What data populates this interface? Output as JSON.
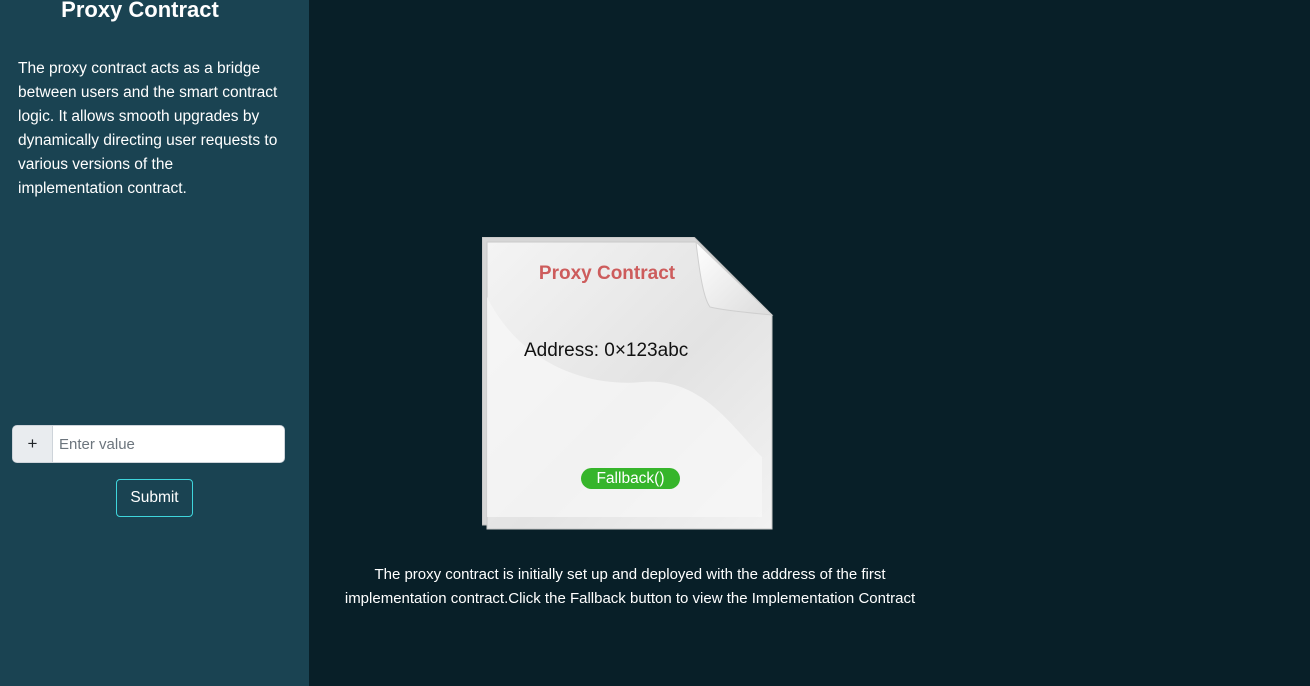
{
  "sidebar": {
    "title": "Proxy Contract",
    "description": "The proxy contract acts as a bridge between users and the smart contract logic. It allows smooth upgrades by dynamically directing user requests to various versions of the implementation contract.",
    "input": {
      "addon_label": "+",
      "placeholder": "Enter value",
      "value": ""
    },
    "submit_label": "Submit"
  },
  "card": {
    "title": "Proxy Contract",
    "address": "Address: 0×123abc",
    "fallback_label": "Fallback()"
  },
  "main": {
    "description": "The proxy contract is initially set up and deployed with the address of the first implementation contract.Click the Fallback button to view the Implementation Contract"
  },
  "colors": {
    "sidebar_bg": "#1a4352",
    "main_bg": "#081f28",
    "card_title": "#cd5c5c",
    "fallback_bg": "#36b52b",
    "submit_border": "#3fd5dc"
  },
  "icons": {
    "addon": "plus-icon"
  }
}
